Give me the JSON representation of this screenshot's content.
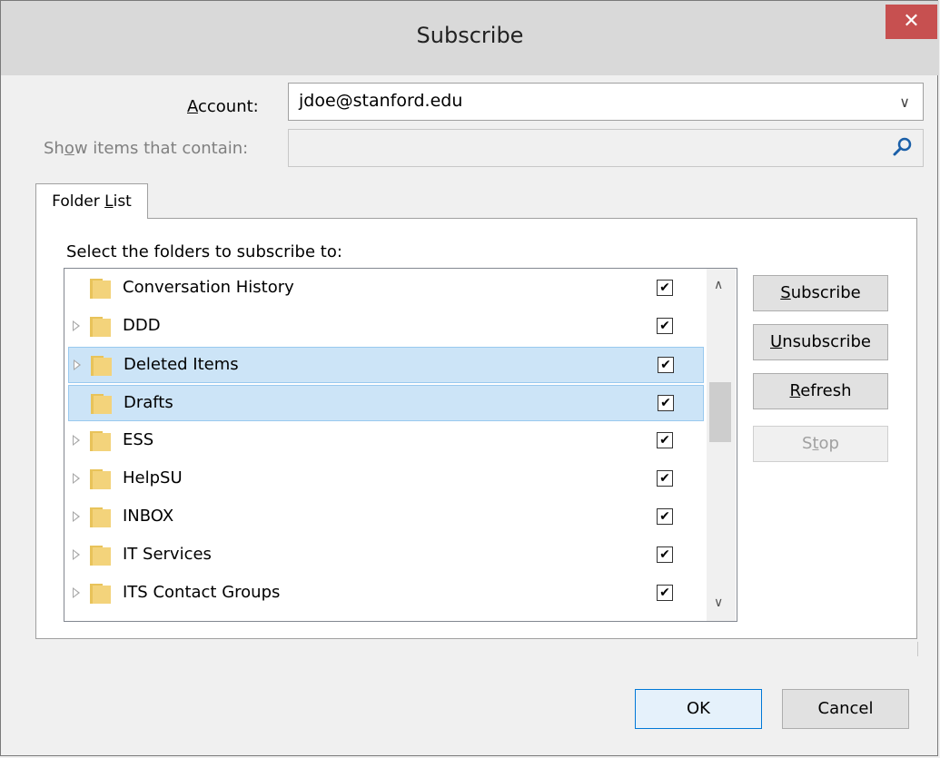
{
  "window": {
    "title": "Subscribe",
    "close_symbol": "✕"
  },
  "account": {
    "label": "Account:",
    "value": "jdoe@stanford.edu"
  },
  "filter": {
    "label": "Show items that contain:",
    "value": ""
  },
  "tab": {
    "label": "Folder List"
  },
  "panel": {
    "instruction": "Select the folders to subscribe to:"
  },
  "folders": [
    {
      "name": "Conversation History",
      "expandable": false,
      "checked": true,
      "selected": false
    },
    {
      "name": "DDD",
      "expandable": true,
      "checked": true,
      "selected": false
    },
    {
      "name": "Deleted Items",
      "expandable": true,
      "checked": true,
      "selected": true
    },
    {
      "name": "Drafts",
      "expandable": false,
      "checked": true,
      "selected": true
    },
    {
      "name": "ESS",
      "expandable": true,
      "checked": true,
      "selected": false
    },
    {
      "name": "HelpSU",
      "expandable": true,
      "checked": true,
      "selected": false
    },
    {
      "name": "INBOX",
      "expandable": true,
      "checked": true,
      "selected": false
    },
    {
      "name": "IT Services",
      "expandable": true,
      "checked": true,
      "selected": false
    },
    {
      "name": "ITS Contact Groups",
      "expandable": true,
      "checked": true,
      "selected": false
    }
  ],
  "side_buttons": {
    "subscribe": "Subscribe",
    "unsubscribe": "Unsubscribe",
    "refresh": "Refresh",
    "stop": "Stop"
  },
  "footer": {
    "ok": "OK",
    "cancel": "Cancel"
  },
  "colors": {
    "close": "#c75050",
    "selection": "#cce4f7",
    "selection_border": "#99c9ef",
    "folder": "#f3d37b"
  }
}
